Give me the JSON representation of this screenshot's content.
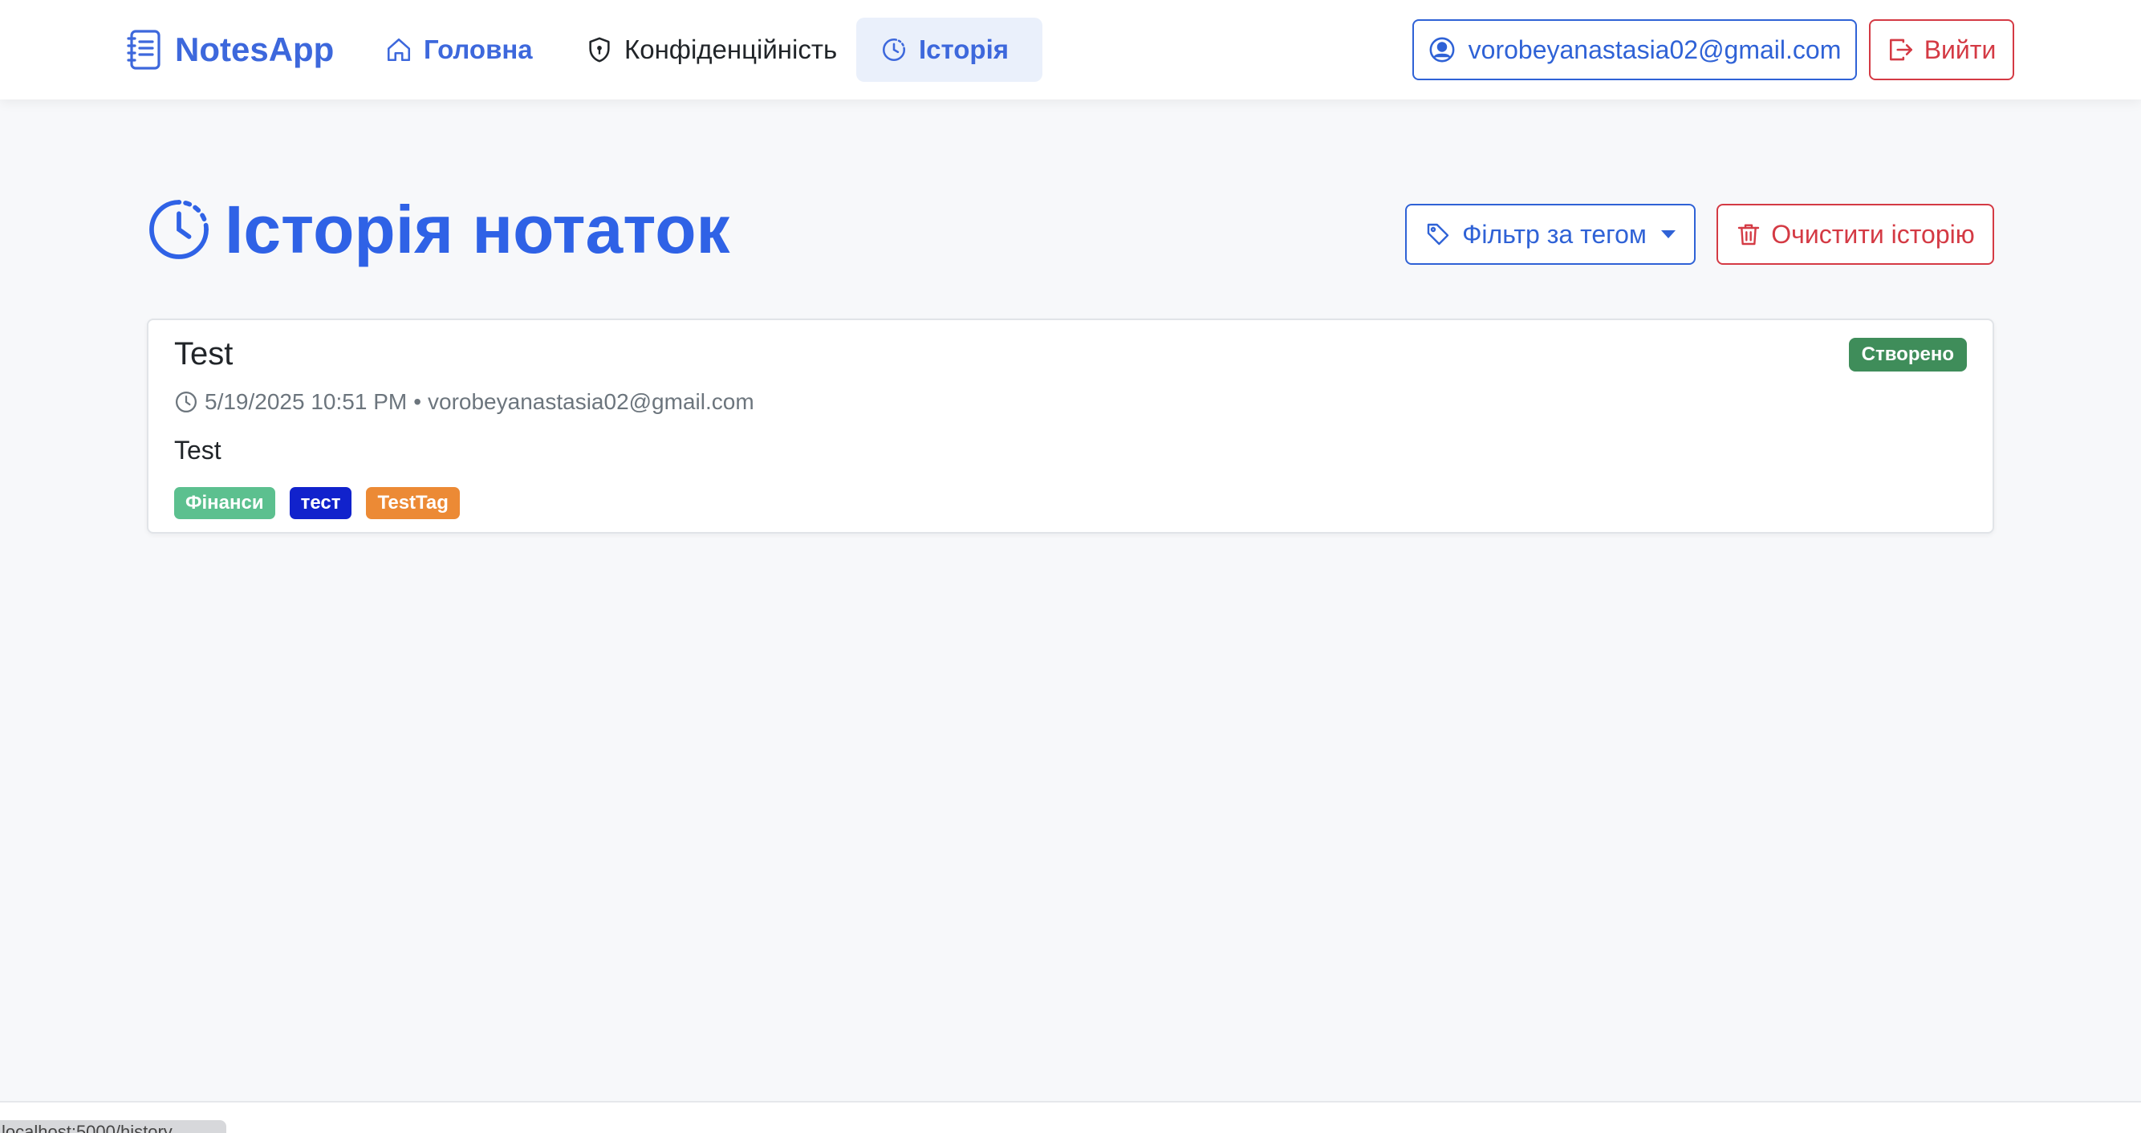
{
  "nav": {
    "brand": "NotesApp",
    "home": "Головна",
    "privacy": "Конфіденційність",
    "history": "Історія",
    "user_email": "vorobeyanastasia02@gmail.com",
    "logout": "Вийти"
  },
  "page": {
    "title": "Історія нотаток",
    "filter_label": "Фільтр за тегом",
    "clear_label": "Очистити історію"
  },
  "notes": [
    {
      "title": "Test",
      "status": "Створено",
      "datetime": "5/19/2025 10:51 PM",
      "separator": "•",
      "author": "vorobeyanastasia02@gmail.com",
      "body": "Test",
      "tags": [
        {
          "label": "Фінанси",
          "color": "#5cc08f"
        },
        {
          "label": "тест",
          "color": "#1122cc"
        },
        {
          "label": "TestTag",
          "color": "#ec8a35"
        }
      ]
    }
  ],
  "colors": {
    "primary": "#3d68dc",
    "danger": "#d43a44",
    "success": "#3f8d5a",
    "background": "#f7f8fa"
  },
  "status_bar_url": "localhost:5000/history"
}
